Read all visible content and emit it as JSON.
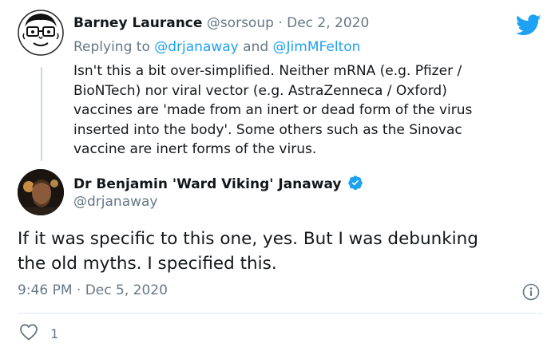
{
  "reply_tweet": {
    "author_name": "Barney Laurance",
    "handle": "@sorsoup",
    "separator": "·",
    "date": "Dec 2, 2020",
    "replying_prefix": "Replying to",
    "replying_to_1": "@drjanaway",
    "replying_and": "and",
    "replying_to_2": "@JimMFelton",
    "lines": [
      "Isn't this a bit over-simplified. Neither mRNA (e.g. Pfizer /",
      "BioNTech) nor viral vector (e.g. AstraZenneca / Oxford)",
      "vaccines are 'made from an inert or dead form of the virus",
      "inserted into the body'. Some others such as the Sinovac",
      "vaccine are inert forms of the virus."
    ]
  },
  "main_tweet": {
    "author_name": "Dr Benjamin 'Ward Viking' Janaway",
    "handle": "@drjanaway",
    "lines": [
      "If it was specific to this one, yes. But I was debunking",
      "the old myths. I specified this."
    ],
    "time": "9:46 PM",
    "separator": "·",
    "date": "Dec 5, 2020",
    "like_count": "1"
  },
  "icons": {
    "brand": "twitter-bird-icon",
    "verified": "verified-badge-icon",
    "info": "info-icon",
    "like": "heart-icon"
  },
  "colors": {
    "twitter_blue": "#1da1f2",
    "muted": "#657786",
    "text": "#14171a"
  }
}
